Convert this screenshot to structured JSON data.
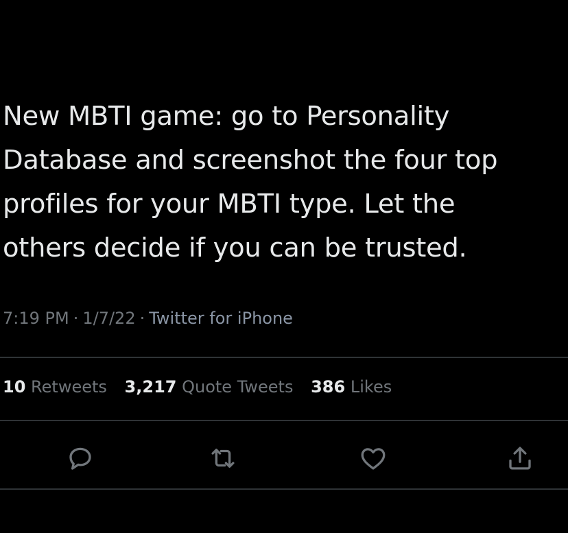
{
  "tweet": {
    "lines": [
      "New MBTI game: go to Personality",
      "Database and screenshot the four top",
      "profiles for your MBTI type. Let the",
      "others decide if you can be trusted."
    ],
    "time": "7:19 PM",
    "date": "1/7/22",
    "separator": "·",
    "source": "Twitter for iPhone"
  },
  "stats": {
    "retweets_count": "10",
    "retweets_label": "Retweets",
    "quote_count": "3,217",
    "quote_label": "Quote Tweets",
    "likes_count": "386",
    "likes_label": "Likes"
  },
  "actions": {
    "reply_icon": "reply-icon",
    "retweet_icon": "retweet-icon",
    "like_icon": "heart-icon",
    "share_icon": "share-icon",
    "icon_color": "#71767b"
  },
  "colors": {
    "background": "#000000",
    "text": "#e7e9ea",
    "secondary": "#71767b",
    "divider": "#2f3336"
  }
}
